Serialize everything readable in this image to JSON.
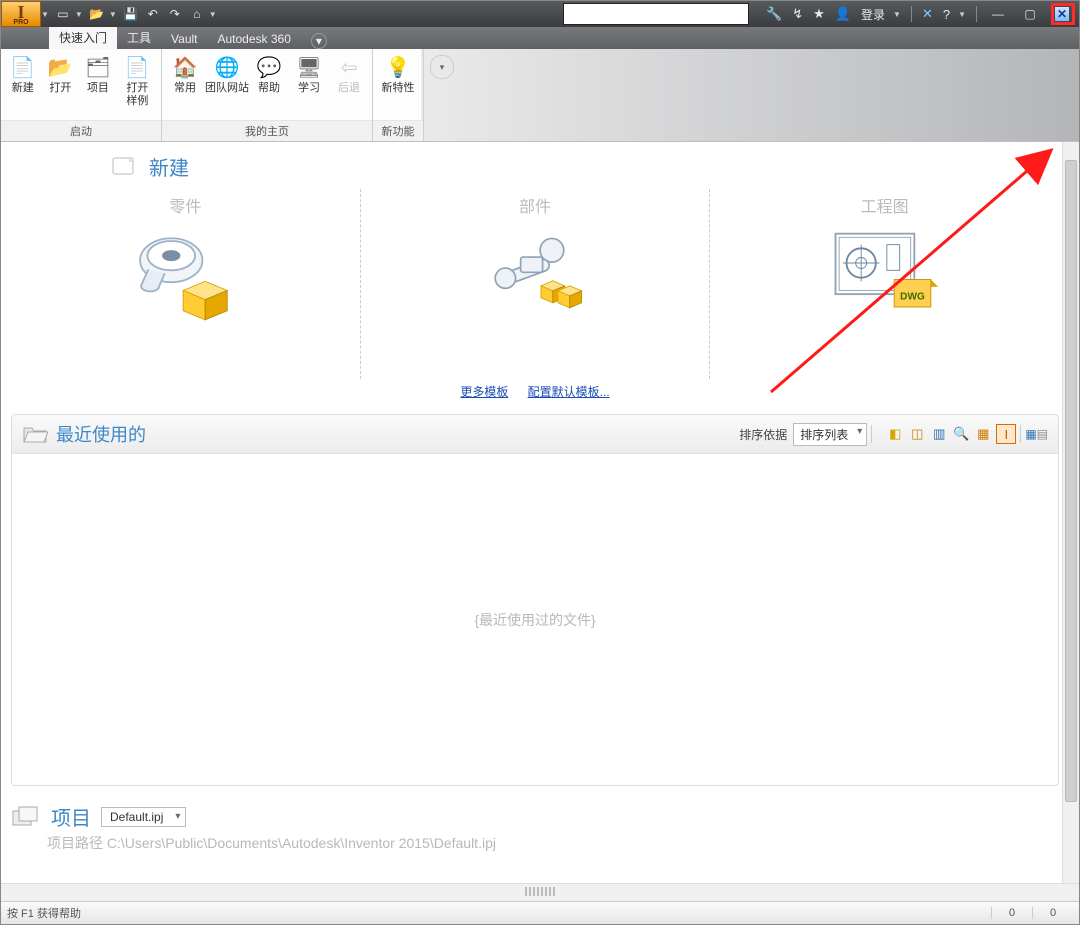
{
  "title": {
    "appicon_big": "I",
    "appicon_small": "PRO",
    "login": "登录"
  },
  "tabs": {
    "quickstart": "快速入门",
    "tools": "工具",
    "vault": "Vault",
    "a360": "Autodesk 360"
  },
  "ribbon": {
    "launch": {
      "new": "新建",
      "open": "打开",
      "project": "项目",
      "open_sample": "打开\n样例",
      "panel": "启动"
    },
    "home": {
      "common": "常用",
      "team": "团队网站",
      "help": "帮助",
      "learn": "学习",
      "back": "后退",
      "panel": "我的主页"
    },
    "newfn": {
      "newfeature": "新特性",
      "panel": "新功能"
    }
  },
  "welcome": {
    "new_title": "新建",
    "col_part": "零件",
    "col_assembly": "部件",
    "col_drawing": "工程图",
    "more_templates": "更多模板",
    "config_templates": "配置默认模板...",
    "recent_title": "最近使用的",
    "sort_label": "排序依据",
    "sort_value": "排序列表",
    "recent_empty": "{最近使用过的文件}",
    "project_title": "项目",
    "project_value": "Default.ipj",
    "project_path_label": "项目路径",
    "project_path": "C:\\Users\\Public\\Documents\\Autodesk\\Inventor 2015\\Default.ipj",
    "dwg_badge": "DWG"
  },
  "status": {
    "help": "按 F1 获得帮助",
    "cell1": "0",
    "cell2": "0"
  }
}
